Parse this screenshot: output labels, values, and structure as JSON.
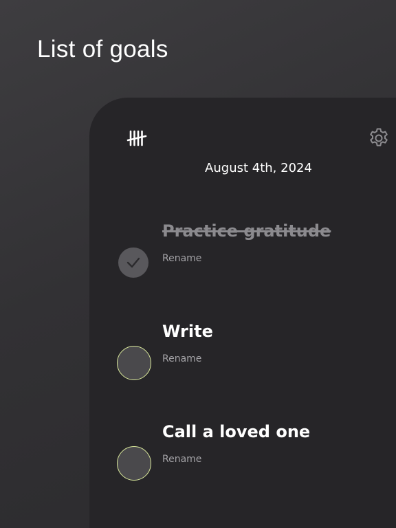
{
  "header": {
    "title": "List of goals"
  },
  "panel": {
    "date": "August 4th, 2024",
    "icons": {
      "app": "tally-marks-icon",
      "settings": "gear-icon"
    },
    "colors": {
      "panel_bg": "#262528",
      "accent_ring": "#d9e89b",
      "done_text": "#8b8a8e"
    },
    "goals": [
      {
        "title": "Practice gratitude",
        "rename_label": "Rename",
        "completed": true
      },
      {
        "title": "Write",
        "rename_label": "Rename",
        "completed": false
      },
      {
        "title": "Call a loved one",
        "rename_label": "Rename",
        "completed": false
      }
    ]
  }
}
